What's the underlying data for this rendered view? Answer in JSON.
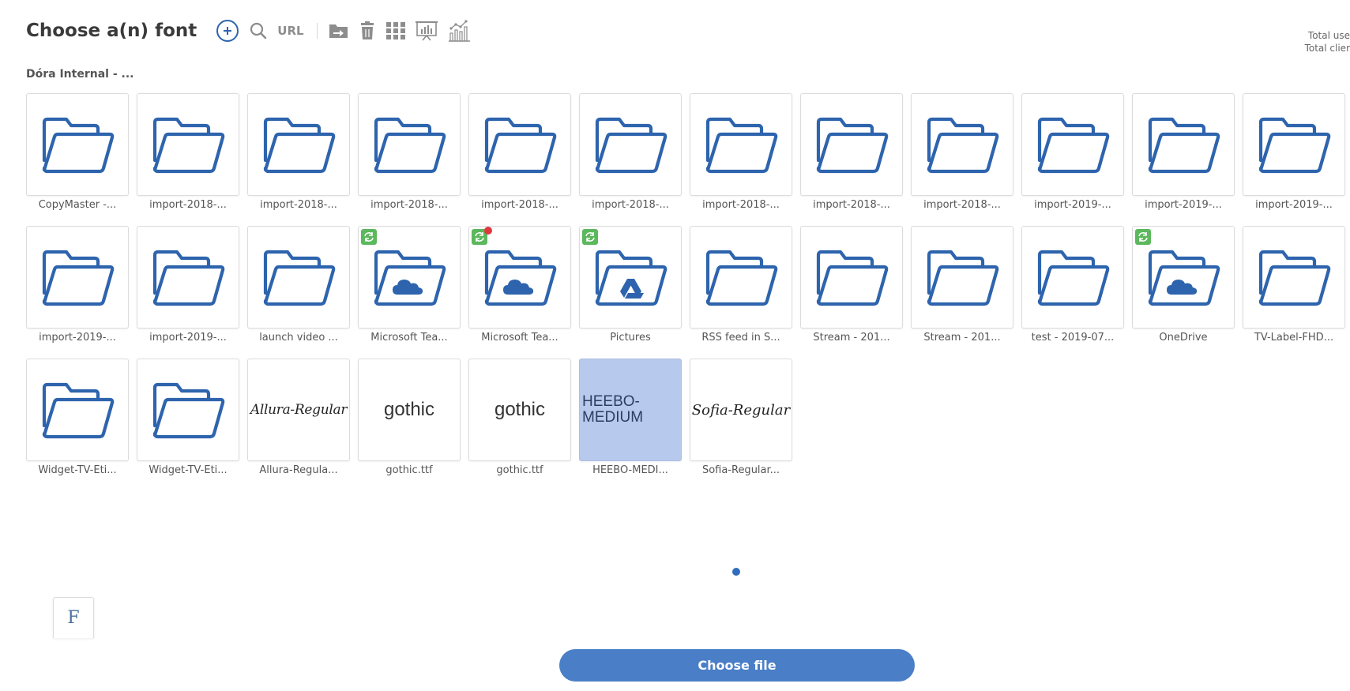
{
  "header": {
    "title": "Choose a(n) font",
    "url_label": "URL",
    "icons": [
      "add-circle-icon",
      "search-icon",
      "url",
      "import-icon",
      "trash-icon",
      "grid-view-icon",
      "presentation-view-icon",
      "stats-view-icon"
    ]
  },
  "totals": {
    "line1": "Total use",
    "line2": "Total clier"
  },
  "breadcrumb": "Dóra Internal - ...",
  "items": [
    {
      "label": "CopyMaster -...",
      "type": "folder"
    },
    {
      "label": "import-2018-...",
      "type": "folder"
    },
    {
      "label": "import-2018-...",
      "type": "folder"
    },
    {
      "label": "import-2018-...",
      "type": "folder"
    },
    {
      "label": "import-2018-...",
      "type": "folder"
    },
    {
      "label": "import-2018-...",
      "type": "folder"
    },
    {
      "label": "import-2018-...",
      "type": "folder"
    },
    {
      "label": "import-2018-...",
      "type": "folder"
    },
    {
      "label": "import-2018-...",
      "type": "folder"
    },
    {
      "label": "import-2019-...",
      "type": "folder"
    },
    {
      "label": "import-2019-...",
      "type": "folder"
    },
    {
      "label": "import-2019-...",
      "type": "folder"
    },
    {
      "label": "import-2019-...",
      "type": "folder"
    },
    {
      "label": "import-2019-...",
      "type": "folder"
    },
    {
      "label": "launch video ...",
      "type": "folder"
    },
    {
      "label": "Microsoft Tea...",
      "type": "onedrive-folder",
      "sync": true
    },
    {
      "label": "Microsoft Tea...",
      "type": "onedrive-folder",
      "sync": true,
      "alert": true
    },
    {
      "label": "Pictures",
      "type": "gdrive-folder",
      "sync": true
    },
    {
      "label": "RSS feed in S...",
      "type": "folder"
    },
    {
      "label": "Stream - 201...",
      "type": "folder"
    },
    {
      "label": "Stream - 201...",
      "type": "folder"
    },
    {
      "label": "test - 2019-07...",
      "type": "folder"
    },
    {
      "label": "OneDrive",
      "type": "onedrive-folder",
      "sync": true
    },
    {
      "label": "TV-Label-FHD...",
      "type": "folder"
    },
    {
      "label": "Widget-TV-Eti...",
      "type": "folder"
    },
    {
      "label": "Widget-TV-Eti...",
      "type": "folder"
    },
    {
      "label": "Allura-Regula...",
      "type": "font",
      "preview": "Allura-Regular",
      "style": "allura"
    },
    {
      "label": "gothic.ttf",
      "type": "font",
      "preview": "gothic",
      "style": "gothic"
    },
    {
      "label": "gothic.ttf",
      "type": "font",
      "preview": "gothic",
      "style": "gothic"
    },
    {
      "label": "HEEBO-MEDI...",
      "type": "font",
      "preview": "HEEBO-\nMEDIUM",
      "style": "heebo",
      "selected": true
    },
    {
      "label": "Sofia-Regular...",
      "type": "font",
      "preview": "Sofia-Regular",
      "style": "sofia"
    }
  ],
  "pagination": {
    "current": 1,
    "total": 1
  },
  "selected_preview_letter": "F",
  "choose_button": "Choose file",
  "colors": {
    "accent": "#4a7fc8",
    "folder_stroke": "#2e64ad",
    "selected_bg": "#b7c9ec",
    "sync_badge": "#5cb85c",
    "alert_dot": "#e0373f"
  }
}
